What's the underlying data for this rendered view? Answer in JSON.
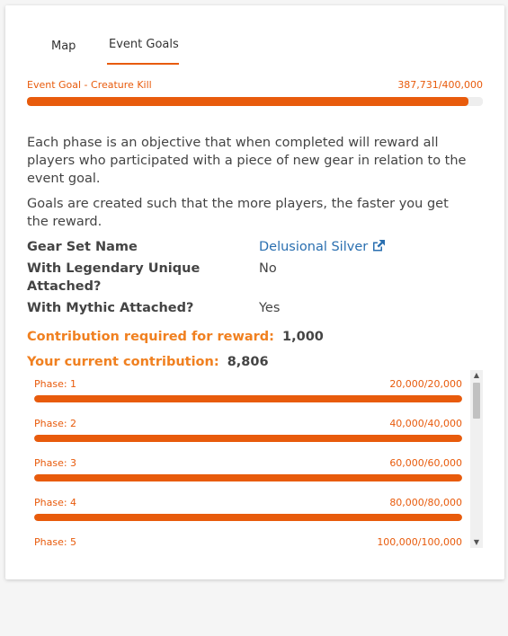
{
  "tabs": [
    {
      "label": "Map"
    },
    {
      "label": "Event Goals"
    }
  ],
  "event_goal": {
    "label": "Event Goal - Creature Kill",
    "progress_text": "387,731/400,000",
    "progress_fraction": 0.969
  },
  "description": {
    "paragraph1": "Each phase is an objective that when completed will reward all players who participated with a piece of new gear in relation to the event goal.",
    "paragraph2": "Goals are created such that the more players, the faster you get the reward."
  },
  "details": {
    "gear_set_name_label": "Gear Set Name",
    "gear_set_name_value": "Delusional Silver",
    "legendary_label": "With Legendary Unique Attached?",
    "legendary_value": "No",
    "mythic_label": "With Mythic Attached?",
    "mythic_value": "Yes"
  },
  "contribution": {
    "required_label": "Contribution required for reward:",
    "required_value": "1,000",
    "current_label": "Your current contribution:",
    "current_value": "8,806"
  },
  "phases": [
    {
      "label": "Phase: 1",
      "progress_text": "20,000/20,000",
      "fraction": 1.0
    },
    {
      "label": "Phase: 2",
      "progress_text": "40,000/40,000",
      "fraction": 1.0
    },
    {
      "label": "Phase: 3",
      "progress_text": "60,000/60,000",
      "fraction": 1.0
    },
    {
      "label": "Phase: 4",
      "progress_text": "80,000/80,000",
      "fraction": 1.0
    },
    {
      "label": "Phase: 5",
      "progress_text": "100,000/100,000",
      "fraction": 1.0
    }
  ],
  "colors": {
    "accent": "#e85b0c",
    "contribution_label": "#f08020",
    "link": "#2a6fb0",
    "track": "#eeeeee"
  },
  "icons": {
    "external_link": "external-link-icon",
    "scroll_up": "scroll-up-arrow-icon",
    "scroll_down": "scroll-down-arrow-icon"
  }
}
